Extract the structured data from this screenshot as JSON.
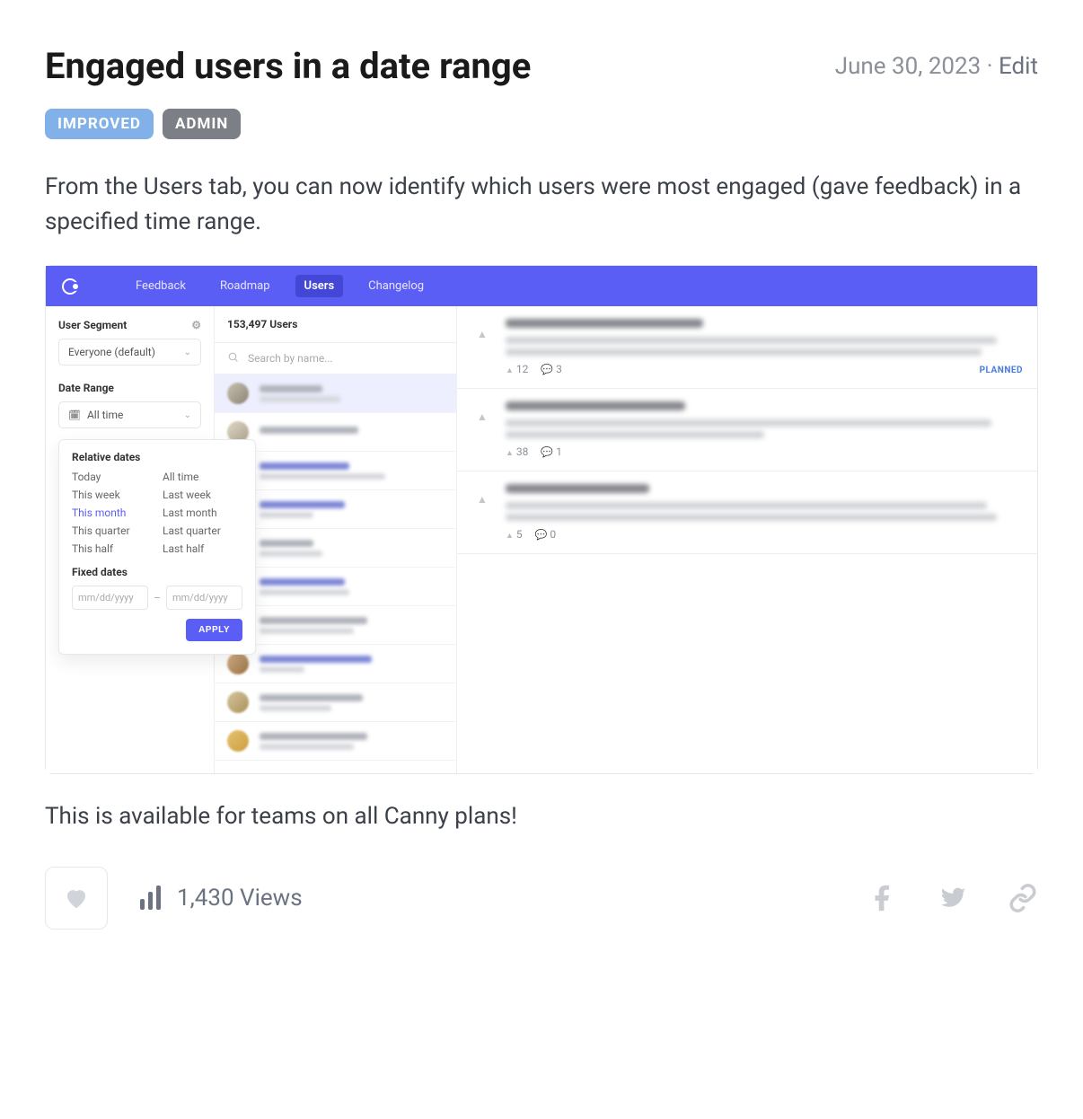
{
  "header": {
    "title": "Engaged users in a date range",
    "date": "June 30, 2023",
    "separator": "·",
    "edit_label": "Edit"
  },
  "tags": [
    {
      "label": "IMPROVED",
      "variant": "improved"
    },
    {
      "label": "ADMIN",
      "variant": "admin"
    }
  ],
  "body_paragraph_1": "From the Users tab, you can now identify which users were most engaged (gave feedback) in a specified time range.",
  "body_paragraph_2": "This is available for teams on all Canny plans!",
  "screenshot": {
    "nav": {
      "items": [
        "Feedback",
        "Roadmap",
        "Users",
        "Changelog"
      ],
      "active": "Users"
    },
    "sidebar": {
      "segment_label": "User Segment",
      "segment_value": "Everyone (default)",
      "date_range_label": "Date Range",
      "date_range_value": "All time"
    },
    "dropdown": {
      "relative_heading": "Relative dates",
      "fixed_heading": "Fixed dates",
      "items_col1": [
        "Today",
        "This week",
        "This month",
        "This quarter",
        "This half"
      ],
      "items_col2": [
        "All time",
        "Last week",
        "Last month",
        "Last quarter",
        "Last half"
      ],
      "active_item": "This month",
      "date_placeholder": "mm/dd/yyyy",
      "date_sep": "–",
      "apply_label": "APPLY"
    },
    "users": {
      "count_label": "153,497 Users",
      "search_placeholder": "Search by name..."
    },
    "posts": [
      {
        "votes": "12",
        "comments": "3",
        "status": "PLANNED"
      },
      {
        "votes": "38",
        "comments": "1",
        "status": ""
      },
      {
        "votes": "5",
        "comments": "0",
        "status": ""
      }
    ]
  },
  "footer": {
    "views_label": "1,430 Views"
  }
}
